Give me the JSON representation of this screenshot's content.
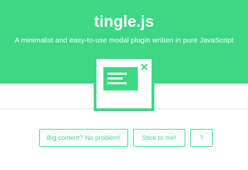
{
  "header": {
    "title": "tingle.js",
    "subtitle": "A minimalist and easy-to-use modal plugin written in pure JavaScript"
  },
  "illustration": {
    "icon": "modal-window-icon",
    "close_glyph": "✕"
  },
  "buttons": {
    "big_content": "Big content? No problem!",
    "sticky": "Stick to me!",
    "help": "?"
  },
  "colors": {
    "accent": "#3ed786",
    "background": "#ffffff"
  }
}
